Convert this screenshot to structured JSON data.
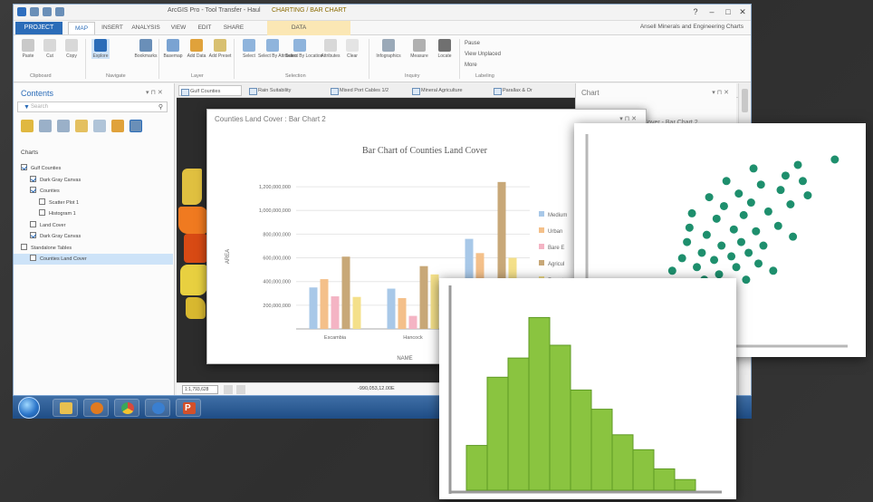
{
  "app": {
    "window_title": "ArcGIS Pro - Tool Transfer - Haul",
    "context_title": "CHARTING / BAR CHART",
    "user_label": "Ansell Minerals and Engineering Charts",
    "window_controls": [
      "?",
      "–",
      "□",
      "✕"
    ],
    "tabs": [
      {
        "label": "PROJECT"
      },
      {
        "label": "MAP",
        "active": true
      },
      {
        "label": "INSERT"
      },
      {
        "label": "ANALYSIS"
      },
      {
        "label": "VIEW"
      },
      {
        "label": "EDIT"
      },
      {
        "label": "SHARE"
      },
      {
        "label": "DATA"
      }
    ],
    "ribbon": {
      "buttons": [
        "Paste",
        "Cut",
        "Copy",
        "Explore",
        "Bookmarks",
        "Basemap",
        "Add Data",
        "Add Preset",
        "Select",
        "Select By Attributes",
        "Select By Location",
        "Attributes",
        "Clear",
        "Infographics",
        "Measure",
        "Locate",
        "Pause",
        "View Unplaced",
        "More"
      ],
      "groups": [
        "Clipboard",
        "Navigate",
        "Layer",
        "Selection",
        "Inquiry",
        "Labeling"
      ]
    }
  },
  "contents": {
    "title": "Contents",
    "controls": "▾ ⊓ ✕",
    "search_placeholder": "Search",
    "heading": "Charts",
    "tree": [
      {
        "label": "Gulf Counties",
        "level": 0,
        "checked": true
      },
      {
        "label": "Dark Gray Canvas",
        "level": 1,
        "checked": true
      },
      {
        "label": "Counties",
        "level": 1,
        "checked": true
      },
      {
        "label": "Scatter Plot 1",
        "level": 2,
        "checked": false
      },
      {
        "label": "Histogram 1",
        "level": 2,
        "checked": false
      },
      {
        "label": "Land Cover",
        "level": 1,
        "checked": false
      },
      {
        "label": "Dark Gray Canvas",
        "level": 1,
        "checked": true
      },
      {
        "label": "Standalone Tables",
        "level": 0,
        "checked": false
      },
      {
        "label": "Counties Land Cover",
        "level": 1,
        "checked": false,
        "selected": true
      }
    ]
  },
  "view_tabs": [
    {
      "label": "Gulf Counties",
      "active": true
    },
    {
      "label": "Rain Suitability"
    },
    {
      "label": "Mixed Port Cables 1/2"
    },
    {
      "label": "Mineral Agriculture"
    },
    {
      "label": "Parallax & Or"
    }
  ],
  "map_status": {
    "scale": "1:1,793,628",
    "coordinates": "-990,053,12.00E"
  },
  "chart_pane": {
    "title": "Chart",
    "controls": "▾ ⊓ ✕",
    "tab_label": "Cover - Bar Chart 2"
  },
  "bar_window": {
    "title": "Counties Land Cover : Bar Chart 2",
    "controls": "▾ ⊓ ✕"
  },
  "colors": {
    "accent": "#2b6cb8",
    "scatter_point": "#1e8f6d",
    "histogram_fill": "#8ac440",
    "histogram_stroke": "#5f9a25"
  },
  "chart_data": [
    {
      "type": "bar",
      "title": "Bar Chart of Counties Land Cover",
      "xlabel": "NAME",
      "ylabel": "AREA",
      "categories": [
        "Escambia",
        "Hancock",
        ""
      ],
      "series": [
        {
          "name": "Medium",
          "color": "#a8c8e8",
          "values": [
            350000000,
            340000000,
            760000000
          ]
        },
        {
          "name": "Urban",
          "color": "#f4c08a",
          "values": [
            420000000,
            260000000,
            640000000
          ]
        },
        {
          "name": "Bare E",
          "color": "#f4b4c4",
          "values": [
            275000000,
            110000000,
            300000000
          ]
        },
        {
          "name": "Agricul",
          "color": "#c8a878",
          "values": [
            610000000,
            530000000,
            1240000000
          ]
        },
        {
          "name": "Forest",
          "color": "#f4e08a",
          "values": [
            270000000,
            460000000,
            600000000
          ]
        }
      ],
      "y_ticks": [
        "200,000,000",
        "400,000,000",
        "600,000,000",
        "800,000,000",
        "1,000,000,000",
        "1,200,000,000"
      ],
      "ylim": [
        0,
        1300000000
      ],
      "grid": true,
      "legend": "right"
    },
    {
      "type": "scatter",
      "points": [
        [
          0.05,
          0.03
        ],
        [
          0.14,
          0.13
        ],
        [
          0.2,
          0.17
        ],
        [
          0.25,
          0.3
        ],
        [
          0.28,
          0.22
        ],
        [
          0.31,
          0.38
        ],
        [
          0.34,
          0.19
        ],
        [
          0.35,
          0.45
        ],
        [
          0.36,
          0.3
        ],
        [
          0.37,
          0.54
        ],
        [
          0.38,
          0.62
        ],
        [
          0.39,
          0.7
        ],
        [
          0.4,
          0.24
        ],
        [
          0.41,
          0.4
        ],
        [
          0.43,
          0.48
        ],
        [
          0.44,
          0.33
        ],
        [
          0.45,
          0.58
        ],
        [
          0.46,
          0.79
        ],
        [
          0.47,
          0.26
        ],
        [
          0.48,
          0.44
        ],
        [
          0.49,
          0.67
        ],
        [
          0.5,
          0.36
        ],
        [
          0.51,
          0.52
        ],
        [
          0.52,
          0.74
        ],
        [
          0.53,
          0.88
        ],
        [
          0.54,
          0.28
        ],
        [
          0.55,
          0.46
        ],
        [
          0.56,
          0.61
        ],
        [
          0.57,
          0.4
        ],
        [
          0.58,
          0.81
        ],
        [
          0.59,
          0.54
        ],
        [
          0.6,
          0.69
        ],
        [
          0.61,
          0.33
        ],
        [
          0.62,
          0.48
        ],
        [
          0.63,
          0.76
        ],
        [
          0.64,
          0.95
        ],
        [
          0.65,
          0.6
        ],
        [
          0.66,
          0.42
        ],
        [
          0.67,
          0.86
        ],
        [
          0.68,
          0.52
        ],
        [
          0.7,
          0.71
        ],
        [
          0.72,
          0.38
        ],
        [
          0.74,
          0.63
        ],
        [
          0.75,
          0.83
        ],
        [
          0.77,
          0.91
        ],
        [
          0.79,
          0.75
        ],
        [
          0.8,
          0.57
        ],
        [
          0.82,
          0.97
        ],
        [
          0.84,
          0.88
        ],
        [
          0.86,
          0.8
        ],
        [
          0.97,
          1.0
        ]
      ],
      "xlim": [
        0,
        1
      ],
      "ylim": [
        0,
        1
      ],
      "grid": false
    },
    {
      "type": "histogram",
      "values": [
        0.21,
        0.53,
        0.62,
        0.81,
        0.68,
        0.47,
        0.38,
        0.26,
        0.19,
        0.1,
        0.05
      ],
      "ylim": [
        0,
        0.85
      ],
      "grid": false
    }
  ]
}
